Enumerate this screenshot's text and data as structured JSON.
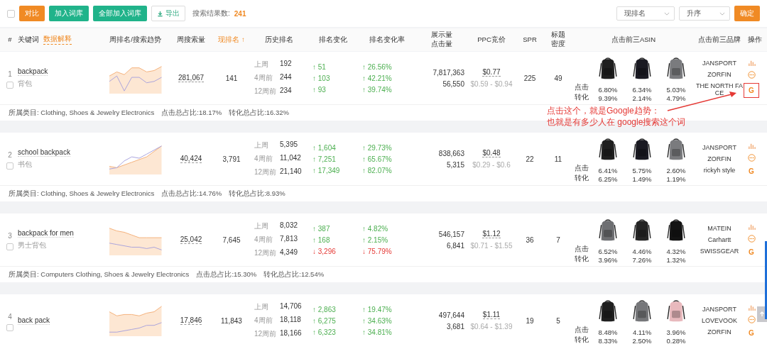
{
  "toolbar": {
    "select_all_checked": false,
    "buttons": [
      {
        "label": "对比",
        "kind": "primary"
      },
      {
        "label": "加入词库",
        "kind": "teal"
      },
      {
        "label": "全部加入词库",
        "kind": "teal"
      },
      {
        "label": "导出",
        "kind": "export"
      }
    ],
    "result_label": "搜索结果数:",
    "result_count": "241",
    "sort_field": "现排名",
    "sort_order": "升序",
    "confirm": "确定"
  },
  "columns": [
    {
      "label": "#"
    },
    {
      "label": "关键词",
      "link": "数据解释"
    },
    {
      "label": "周排名/搜索趋势"
    },
    {
      "label": "周搜索量"
    },
    {
      "label": "现排名 ↑",
      "sorted": true
    },
    {
      "label": "历史排名"
    },
    {
      "label": "排名变化"
    },
    {
      "label": "排名变化率"
    },
    {
      "label": "展示量",
      "label2": "点击量"
    },
    {
      "label": "PPC竞价"
    },
    {
      "label": "SPR"
    },
    {
      "label": "标题",
      "label2": "密度"
    },
    {
      "label": "点击前三ASIN"
    },
    {
      "label": "点击前三品牌"
    },
    {
      "label": "操作"
    }
  ],
  "rows": [
    {
      "index": "1",
      "keyword": "backpack",
      "translation": "背包",
      "checked": false,
      "volume": "281,067",
      "rank": "141",
      "history": [
        {
          "label": "上周",
          "value": "192"
        },
        {
          "label": "4周前",
          "value": "244"
        },
        {
          "label": "12周前",
          "value": "234"
        }
      ],
      "changes": [
        {
          "text": "↑ 51",
          "rising": true
        },
        {
          "text": "↑ 103",
          "rising": true
        },
        {
          "text": "↑ 93",
          "rising": true
        }
      ],
      "rates": [
        {
          "text": "↑ 26.56%",
          "rising": true
        },
        {
          "text": "↑ 42.21%",
          "rising": true
        },
        {
          "text": "↑ 39.74%",
          "rising": true
        }
      ],
      "impressions": "7,817,363",
      "clicks": "56,550",
      "ppc": "$0.77",
      "ppc_range": "$0.59 - $0.94",
      "spr": "225",
      "density": "49",
      "click_label": "点击",
      "conv_label": "转化",
      "asins": [
        {
          "color": "#1f1f1f",
          "click": "6.80%",
          "conv": "9.39%"
        },
        {
          "color": "#1a1a22",
          "click": "6.34%",
          "conv": "2.14%"
        },
        {
          "color": "#7a7b7e",
          "click": "5.03%",
          "conv": "4.79%"
        }
      ],
      "brands": [
        "JANSPORT",
        "ZORFIN",
        "THE NORTH FACE"
      ],
      "actions": "G",
      "google_highlighted": true,
      "footer": {
        "category": "所属类目: Clothing, Shoes & Jewelry Electronics",
        "click_share": "点击总占比:18.17%",
        "conv_share": "转化总占比:16.32%"
      }
    },
    {
      "index": "2",
      "keyword": "school backpack",
      "translation": "书包",
      "checked": false,
      "volume": "40,424",
      "rank": "3,791",
      "history": [
        {
          "label": "上周",
          "value": "5,395"
        },
        {
          "label": "4周前",
          "value": "11,042"
        },
        {
          "label": "12周前",
          "value": "21,140"
        }
      ],
      "changes": [
        {
          "text": "↑ 1,604",
          "rising": true
        },
        {
          "text": "↑ 7,251",
          "rising": true
        },
        {
          "text": "↑ 17,349",
          "rising": true
        }
      ],
      "rates": [
        {
          "text": "↑ 29.73%",
          "rising": true
        },
        {
          "text": "↑ 65.67%",
          "rising": true
        },
        {
          "text": "↑ 82.07%",
          "rising": true
        }
      ],
      "impressions": "838,663",
      "clicks": "5,315",
      "ppc": "$0.48",
      "ppc_range": "$0.29 - $0.6",
      "spr": "22",
      "density": "11",
      "click_label": "点击",
      "conv_label": "转化",
      "asins": [
        {
          "color": "#1f1f1f",
          "click": "6.41%",
          "conv": "6.25%"
        },
        {
          "color": "#1a1a22",
          "click": "5.75%",
          "conv": "1.49%"
        },
        {
          "color": "#7a7b7e",
          "click": "2.60%",
          "conv": "1.19%"
        }
      ],
      "brands": [
        "JANSPORT",
        "ZORFIN",
        "rickyh style"
      ],
      "actions": "G",
      "google_highlighted": false,
      "footer": {
        "category": "所属类目: Clothing, Shoes & Jewelry Electronics",
        "click_share": "点击总占比:14.76%",
        "conv_share": "转化总占比:8.93%"
      }
    },
    {
      "index": "3",
      "keyword": "backpack for men",
      "translation": "男士背包",
      "checked": false,
      "volume": "25,042",
      "rank": "7,645",
      "history": [
        {
          "label": "上周",
          "value": "8,032"
        },
        {
          "label": "4周前",
          "value": "7,813"
        },
        {
          "label": "12周前",
          "value": "4,349"
        }
      ],
      "changes": [
        {
          "text": "↑ 387",
          "rising": true
        },
        {
          "text": "↑ 168",
          "rising": true
        },
        {
          "text": "↓ 3,296",
          "rising": false
        }
      ],
      "rates": [
        {
          "text": "↑ 4.82%",
          "rising": true
        },
        {
          "text": "↑ 2.15%",
          "rising": true
        },
        {
          "text": "↓ 75.79%",
          "rising": false
        }
      ],
      "impressions": "546,157",
      "clicks": "6,841",
      "ppc": "$1.12",
      "ppc_range": "$0.71 - $1.55",
      "spr": "36",
      "density": "7",
      "click_label": "点击",
      "conv_label": "转化",
      "asins": [
        {
          "color": "#6e6f72",
          "click": "6.52%",
          "conv": "3.96%"
        },
        {
          "color": "#252525",
          "click": "4.46%",
          "conv": "7.26%"
        },
        {
          "color": "#141414",
          "click": "4.32%",
          "conv": "1.32%"
        }
      ],
      "brands": [
        "MATEIN",
        "Carhartt",
        "SWISSGEAR"
      ],
      "actions": "G",
      "google_highlighted": false,
      "footer": {
        "category": "所属类目: Computers Clothing, Shoes & Jewelry Electronics",
        "click_share": "点击总占比:15.30%",
        "conv_share": "转化总占比:12.54%"
      }
    },
    {
      "index": "4",
      "keyword": "back pack",
      "checked": false,
      "volume": "17,846",
      "rank": "11,843",
      "history": [
        {
          "label": "上周",
          "value": "14,706"
        },
        {
          "label": "4周前",
          "value": "18,118"
        },
        {
          "label": "12周前",
          "value": "18,166"
        }
      ],
      "changes": [
        {
          "text": "↑ 2,863",
          "rising": true
        },
        {
          "text": "↑ 6,275",
          "rising": true
        },
        {
          "text": "↑ 6,323",
          "rising": true
        }
      ],
      "rates": [
        {
          "text": "↑ 19.47%",
          "rising": true
        },
        {
          "text": "↑ 34.63%",
          "rising": true
        },
        {
          "text": "↑ 34.81%",
          "rising": true
        }
      ],
      "impressions": "497,644",
      "clicks": "3,681",
      "ppc": "$1.11",
      "ppc_range": "$0.64 - $1.39",
      "spr": "19",
      "density": "5",
      "click_label": "点击",
      "conv_label": "转化",
      "asins": [
        {
          "color": "#1f1f1f",
          "click": "8.48%",
          "conv": "8.33%"
        },
        {
          "color": "#76777a",
          "click": "4.11%",
          "conv": "2.50%"
        },
        {
          "color": "#e8b9bd",
          "click": "3.96%",
          "conv": "0.28%"
        }
      ],
      "brands": [
        "JANSPORT",
        "LOVEVOOK",
        "ZORFIN"
      ],
      "actions": "G",
      "google_highlighted": false
    }
  ],
  "annotation": {
    "lines": [
      "点击这个，就是Google趋势：",
      "也就是有多少人在 google搜索这个词"
    ]
  }
}
